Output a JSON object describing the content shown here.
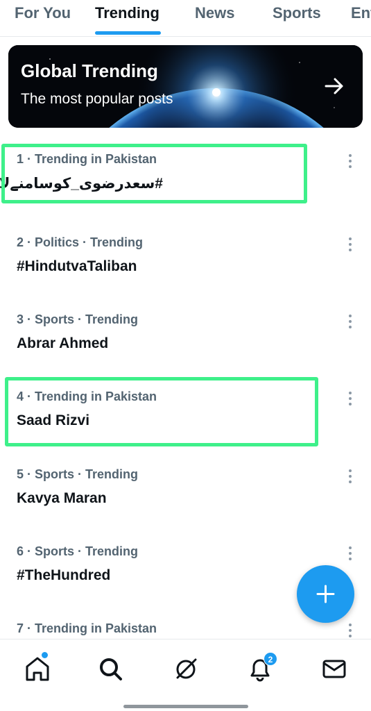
{
  "tabs": [
    {
      "label": "For You",
      "active": false
    },
    {
      "label": "Trending",
      "active": true
    },
    {
      "label": "News",
      "active": false
    },
    {
      "label": "Sports",
      "active": false
    },
    {
      "label": "Entertainment",
      "active": false
    }
  ],
  "banner": {
    "title": "Global Trending",
    "subtitle": "The most popular posts",
    "arrow_icon": "arrow-right-icon"
  },
  "trends": [
    {
      "meta": "1 · Trending in Pakistan",
      "name": "#سعدرضوی_کوسامنےلاؤ",
      "highlighted": true
    },
    {
      "meta": "2 · Politics · Trending",
      "name": "#HindutvaTaliban",
      "highlighted": false
    },
    {
      "meta": "3 · Sports · Trending",
      "name": "Abrar Ahmed",
      "highlighted": false
    },
    {
      "meta": "4 · Trending in Pakistan",
      "name": "Saad Rizvi",
      "highlighted": true
    },
    {
      "meta": "5 · Sports · Trending",
      "name": "Kavya Maran",
      "highlighted": false
    },
    {
      "meta": "6 · Sports · Trending",
      "name": "#TheHundred",
      "highlighted": false
    },
    {
      "meta": "7 · Trending in Pakistan",
      "name": "",
      "highlighted": false
    }
  ],
  "fab": {
    "icon": "plus-icon"
  },
  "bottom_nav": {
    "items": [
      "home-icon",
      "search-icon",
      "grok-icon",
      "bell-icon",
      "mail-icon"
    ],
    "notification_count": "2"
  },
  "colors": {
    "accent": "#1d9bf0",
    "highlight": "#3ef08a",
    "secondary_text": "#536471"
  }
}
